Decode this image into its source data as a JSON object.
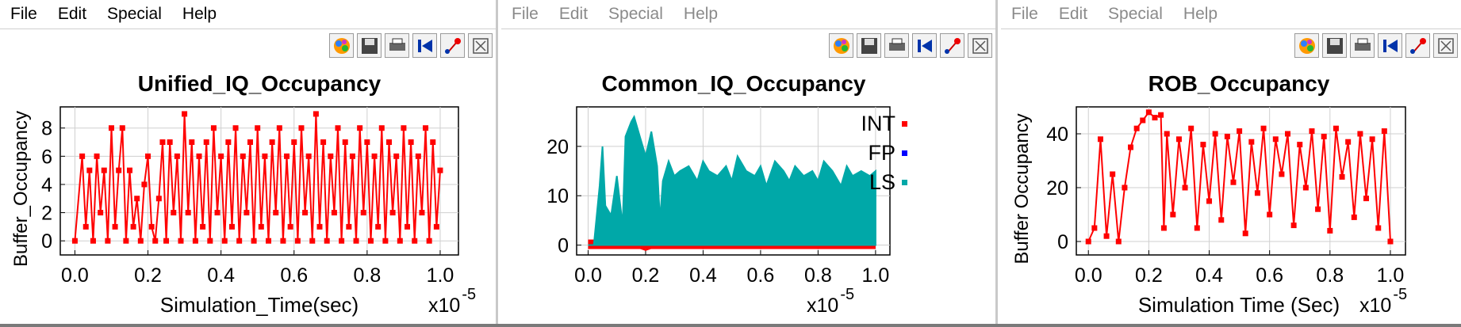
{
  "menu": [
    "File",
    "Edit",
    "Special",
    "Help"
  ],
  "toolbar_icons": [
    "palette-icon",
    "save-icon",
    "print-icon",
    "rewind-icon",
    "marker-icon",
    "zoom-fit-icon"
  ],
  "colors": {
    "int": "#ff0000",
    "fp": "#0000ff",
    "ls": "#00a8a8"
  },
  "panels": [
    {
      "menu_active": true,
      "title": "Unified_IQ_Occupancy",
      "ylabel": "Buffer_Occupancy",
      "xlabel": "Simulation_Time(sec)",
      "x_exponent": "x10",
      "x_exponent_power": "-5",
      "xticks": [
        "0.0",
        "0.2",
        "0.4",
        "0.6",
        "0.8",
        "1.0"
      ],
      "yticks": [
        "0",
        "2",
        "4",
        "6",
        "8"
      ]
    },
    {
      "menu_active": false,
      "title": "Common_IQ_Occupancy",
      "ylabel": "",
      "xlabel": "",
      "x_exponent": "x10",
      "x_exponent_power": "-5",
      "xticks": [
        "0.0",
        "0.2",
        "0.4",
        "0.6",
        "0.8",
        "1.0"
      ],
      "yticks": [
        "0",
        "10",
        "20"
      ],
      "legend": [
        "INT",
        "FP",
        "LS"
      ]
    },
    {
      "menu_active": false,
      "title": "ROB_Occupancy",
      "ylabel": "Buffer Occupancy",
      "xlabel": "Simulation Time (Sec)",
      "x_exponent": "x10",
      "x_exponent_power": "-5",
      "xticks": [
        "0.0",
        "0.2",
        "0.4",
        "0.6",
        "0.8",
        "1.0"
      ],
      "yticks": [
        "0",
        "20",
        "40"
      ]
    }
  ],
  "chart_data": [
    {
      "type": "line",
      "title": "Unified_IQ_Occupancy",
      "xlabel": "Simulation_Time(sec)",
      "ylabel": "Buffer_Occupancy",
      "xscale": "x10^-5",
      "xlim": [
        -0.04,
        1.05
      ],
      "ylim": [
        -1,
        9.5
      ],
      "grid": true,
      "series": [
        {
          "color": "#ff0000",
          "x": [
            0.0,
            0.02,
            0.03,
            0.04,
            0.05,
            0.06,
            0.07,
            0.08,
            0.09,
            0.1,
            0.11,
            0.12,
            0.13,
            0.14,
            0.15,
            0.16,
            0.17,
            0.18,
            0.19,
            0.2,
            0.21,
            0.22,
            0.23,
            0.24,
            0.25,
            0.26,
            0.27,
            0.28,
            0.29,
            0.3,
            0.31,
            0.32,
            0.33,
            0.34,
            0.35,
            0.36,
            0.37,
            0.38,
            0.39,
            0.4,
            0.41,
            0.42,
            0.43,
            0.44,
            0.45,
            0.46,
            0.47,
            0.48,
            0.49,
            0.5,
            0.51,
            0.52,
            0.53,
            0.54,
            0.55,
            0.56,
            0.57,
            0.58,
            0.59,
            0.6,
            0.61,
            0.62,
            0.63,
            0.64,
            0.65,
            0.66,
            0.67,
            0.68,
            0.69,
            0.7,
            0.71,
            0.72,
            0.73,
            0.74,
            0.75,
            0.76,
            0.77,
            0.78,
            0.79,
            0.8,
            0.81,
            0.82,
            0.83,
            0.84,
            0.85,
            0.86,
            0.87,
            0.88,
            0.89,
            0.9,
            0.91,
            0.92,
            0.93,
            0.94,
            0.95,
            0.96,
            0.97,
            0.98,
            0.99,
            1.0
          ],
          "y": [
            0,
            6,
            1,
            5,
            0,
            6,
            2,
            5,
            0,
            8,
            1,
            5,
            8,
            0,
            5,
            1,
            3,
            0,
            4,
            6,
            1,
            0,
            3,
            7,
            0,
            7,
            2,
            6,
            0,
            9,
            2,
            7,
            0,
            6,
            1,
            7,
            0,
            8,
            2,
            6,
            0,
            7,
            1,
            8,
            0,
            6,
            2,
            7,
            0,
            8,
            1,
            6,
            0,
            7,
            2,
            8,
            0,
            6,
            1,
            7,
            0,
            8,
            2,
            6,
            0,
            9,
            1,
            7,
            0,
            6,
            2,
            8,
            0,
            7,
            1,
            6,
            0,
            8,
            2,
            7,
            0,
            6,
            1,
            8,
            0,
            7,
            2,
            6,
            0,
            8,
            1,
            7,
            0,
            6,
            2,
            8,
            0,
            7,
            1,
            5
          ]
        }
      ]
    },
    {
      "type": "line",
      "title": "Common_IQ_Occupancy",
      "xscale": "x10^-5",
      "xlim": [
        -0.04,
        1.05
      ],
      "ylim": [
        -2,
        28
      ],
      "grid": true,
      "series": [
        {
          "name": "INT",
          "color": "#ff0000",
          "x": [
            0.0,
            0.05,
            0.1,
            0.15,
            0.2,
            0.25,
            0.3,
            0.4,
            0.5,
            0.6,
            0.7,
            0.8,
            0.9,
            1.0
          ],
          "y": [
            0,
            0,
            0,
            0,
            -1,
            0,
            0,
            0,
            0,
            0,
            0,
            0,
            0,
            0
          ]
        },
        {
          "name": "FP",
          "color": "#0000ff",
          "x": [],
          "y": []
        },
        {
          "name": "LS",
          "color": "#00a8a8",
          "x": [
            0.0,
            0.02,
            0.04,
            0.05,
            0.06,
            0.08,
            0.1,
            0.12,
            0.13,
            0.15,
            0.16,
            0.17,
            0.18,
            0.2,
            0.22,
            0.24,
            0.25,
            0.26,
            0.28,
            0.3,
            0.32,
            0.35,
            0.38,
            0.4,
            0.42,
            0.45,
            0.48,
            0.5,
            0.52,
            0.55,
            0.58,
            0.6,
            0.62,
            0.65,
            0.68,
            0.7,
            0.72,
            0.75,
            0.78,
            0.8,
            0.82,
            0.85,
            0.88,
            0.9,
            0.92,
            0.95,
            0.98,
            1.0
          ],
          "y": [
            0,
            0,
            12,
            20,
            8,
            6,
            14,
            4,
            22,
            25,
            26,
            24,
            22,
            18,
            23,
            16,
            5,
            13,
            17,
            14,
            15,
            16,
            13,
            17,
            15,
            14,
            16,
            13,
            18,
            15,
            14,
            16,
            12,
            17,
            15,
            13,
            16,
            14,
            15,
            13,
            17,
            15,
            12,
            16,
            14,
            15,
            14,
            15
          ]
        }
      ],
      "legend": "right"
    },
    {
      "type": "line",
      "title": "ROB_Occupancy",
      "xlabel": "Simulation Time (Sec)",
      "ylabel": "Buffer Occupancy",
      "xscale": "x10^-5",
      "xlim": [
        -0.04,
        1.05
      ],
      "ylim": [
        -5,
        50
      ],
      "grid": true,
      "series": [
        {
          "color": "#ff0000",
          "x": [
            0.0,
            0.02,
            0.04,
            0.06,
            0.08,
            0.1,
            0.12,
            0.14,
            0.16,
            0.18,
            0.2,
            0.22,
            0.24,
            0.25,
            0.26,
            0.28,
            0.3,
            0.32,
            0.34,
            0.36,
            0.38,
            0.4,
            0.42,
            0.44,
            0.46,
            0.48,
            0.5,
            0.52,
            0.54,
            0.56,
            0.58,
            0.6,
            0.62,
            0.64,
            0.66,
            0.68,
            0.7,
            0.72,
            0.74,
            0.76,
            0.78,
            0.8,
            0.82,
            0.84,
            0.86,
            0.88,
            0.9,
            0.92,
            0.94,
            0.96,
            0.98,
            1.0
          ],
          "y": [
            0,
            5,
            38,
            2,
            25,
            0,
            20,
            35,
            42,
            45,
            48,
            46,
            47,
            5,
            40,
            10,
            38,
            20,
            42,
            5,
            36,
            15,
            40,
            8,
            39,
            22,
            41,
            3,
            37,
            18,
            42,
            10,
            38,
            25,
            40,
            6,
            36,
            20,
            41,
            12,
            39,
            4,
            42,
            24,
            37,
            9,
            40,
            16,
            38,
            5,
            41,
            0
          ]
        }
      ]
    }
  ]
}
